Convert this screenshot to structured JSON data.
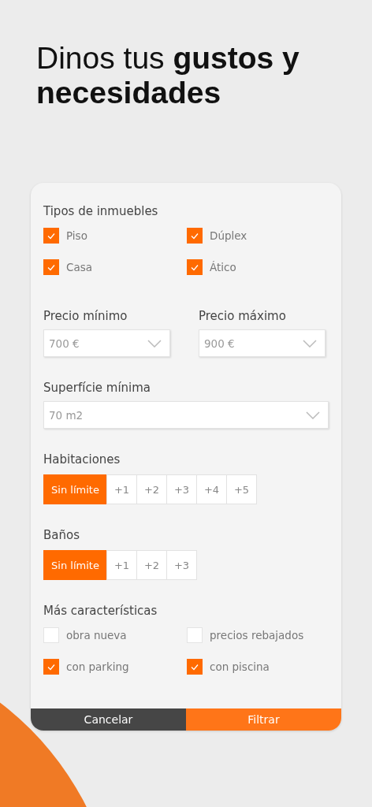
{
  "title": "Dinos tus **gustos y necesidades**",
  "sections": [
    {
      "kind": "checks",
      "heading": "Tipos de inmuebles",
      "options": [
        {
          "label": "Piso",
          "checked": true
        },
        {
          "label": "Dúplex",
          "checked": true
        },
        {
          "label": "Casa",
          "checked": true
        },
        {
          "label": "Ático",
          "checked": true
        }
      ]
    },
    {
      "kind": "selects",
      "fields": [
        {
          "label": "Precio mínimo",
          "value": "700 €"
        },
        {
          "label": "Precio máximo",
          "value": "900 €"
        }
      ]
    },
    {
      "kind": "selects",
      "fields": [
        {
          "label": "Superfície mínima",
          "value": "70 m2"
        }
      ]
    },
    {
      "kind": "segments",
      "heading": "Habitaciones",
      "options": [
        {
          "label": "Sin límite",
          "selected": true
        },
        {
          "label": "+1",
          "selected": false
        },
        {
          "label": "+2",
          "selected": false
        },
        {
          "label": "+3",
          "selected": false
        },
        {
          "label": "+4",
          "selected": false
        },
        {
          "label": "+5",
          "selected": false
        }
      ]
    },
    {
      "kind": "segments",
      "heading": "Baños",
      "options": [
        {
          "label": "Sin límite",
          "selected": true
        },
        {
          "label": "+1",
          "selected": false
        },
        {
          "label": "+2",
          "selected": false
        },
        {
          "label": "+3",
          "selected": false
        }
      ]
    },
    {
      "kind": "checks",
      "heading": "Más características",
      "options": [
        {
          "label": "obra nueva",
          "checked": false
        },
        {
          "label": "precios rebajados",
          "checked": false
        },
        {
          "label": "con parking",
          "checked": true
        },
        {
          "label": "con piscina",
          "checked": true
        }
      ]
    }
  ],
  "actions": [
    {
      "label": "Cancelar",
      "kind": "secondary"
    },
    {
      "label": "Filtrar",
      "kind": "primary"
    }
  ]
}
